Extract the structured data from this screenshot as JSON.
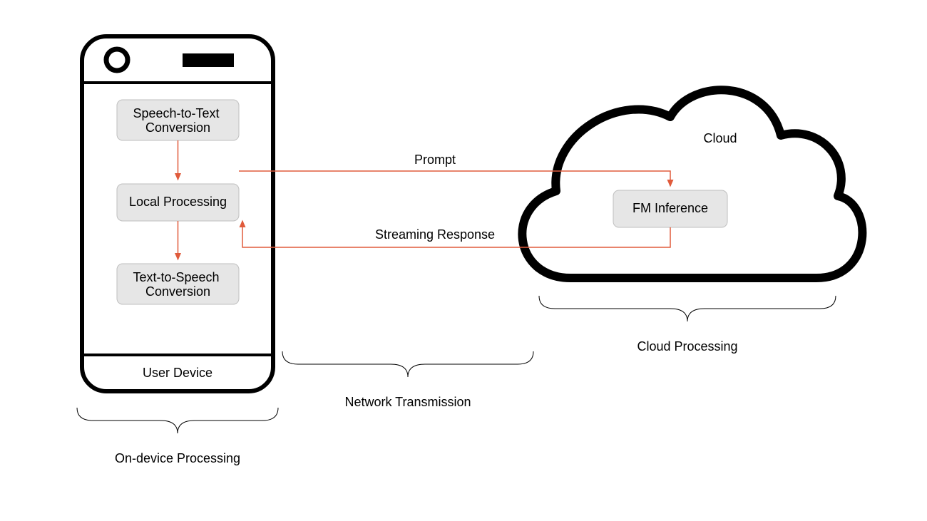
{
  "device": {
    "step1": "Speech-to-Text Conversion",
    "step2": "Local Processing",
    "step3": "Text-to-Speech Conversion",
    "bottom_label": "User Device"
  },
  "cloud": {
    "title": "Cloud",
    "box": "FM Inference"
  },
  "arrows": {
    "prompt": "Prompt",
    "response": "Streaming Response"
  },
  "braces": {
    "device": "On-device Processing",
    "network": "Network Transmission",
    "cloud": "Cloud Processing"
  }
}
